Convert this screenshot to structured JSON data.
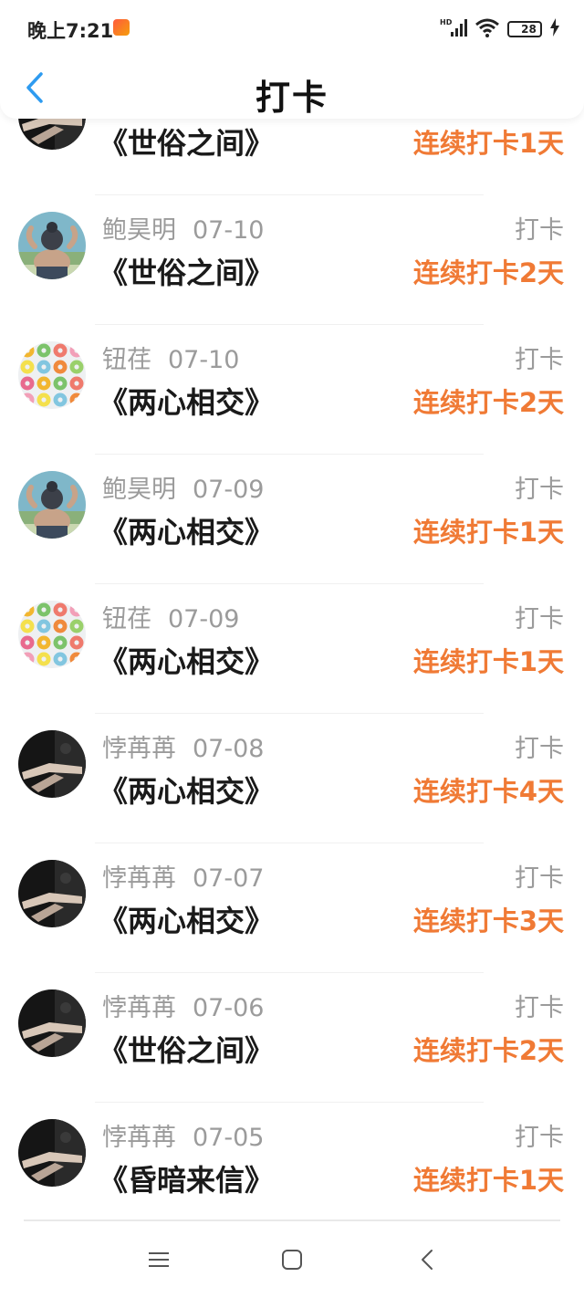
{
  "status_bar": {
    "time": "晚上7:21",
    "battery_level": "28",
    "battery_fraction": 0.28,
    "network_label": "HD"
  },
  "header": {
    "title": "打卡",
    "back_icon": "chevron-left-icon"
  },
  "colors": {
    "accent_orange": "#f07a35",
    "back_blue": "#2e9bf0",
    "muted_gray": "#9b9b9b",
    "title_black": "#111111"
  },
  "list": [
    {
      "user": "",
      "date": "",
      "action": "",
      "book": "《世俗之间》",
      "streak": "连续打卡1天",
      "avatar": "dark-photo"
    },
    {
      "user": "鲍昊明",
      "date": "07-10",
      "action": "打卡",
      "book": "《世俗之间》",
      "streak": "连续打卡2天",
      "avatar": "back-photo"
    },
    {
      "user": "钮荏",
      "date": "07-10",
      "action": "打卡",
      "book": "《两心相交》",
      "streak": "连续打卡2天",
      "avatar": "donuts-photo"
    },
    {
      "user": "鲍昊明",
      "date": "07-09",
      "action": "打卡",
      "book": "《两心相交》",
      "streak": "连续打卡1天",
      "avatar": "back-photo"
    },
    {
      "user": "钮荏",
      "date": "07-09",
      "action": "打卡",
      "book": "《两心相交》",
      "streak": "连续打卡1天",
      "avatar": "donuts-photo"
    },
    {
      "user": "悖苒苒",
      "date": "07-08",
      "action": "打卡",
      "book": "《两心相交》",
      "streak": "连续打卡4天",
      "avatar": "dark-photo"
    },
    {
      "user": "悖苒苒",
      "date": "07-07",
      "action": "打卡",
      "book": "《两心相交》",
      "streak": "连续打卡3天",
      "avatar": "dark-photo"
    },
    {
      "user": "悖苒苒",
      "date": "07-06",
      "action": "打卡",
      "book": "《世俗之间》",
      "streak": "连续打卡2天",
      "avatar": "dark-photo"
    },
    {
      "user": "悖苒苒",
      "date": "07-05",
      "action": "打卡",
      "book": "《昏暗来信》",
      "streak": "连续打卡1天",
      "avatar": "dark-photo"
    }
  ],
  "nav_bar": {
    "menu_icon": "menu-icon",
    "home_icon": "home-square-icon",
    "back_icon": "back-triangle-icon"
  }
}
